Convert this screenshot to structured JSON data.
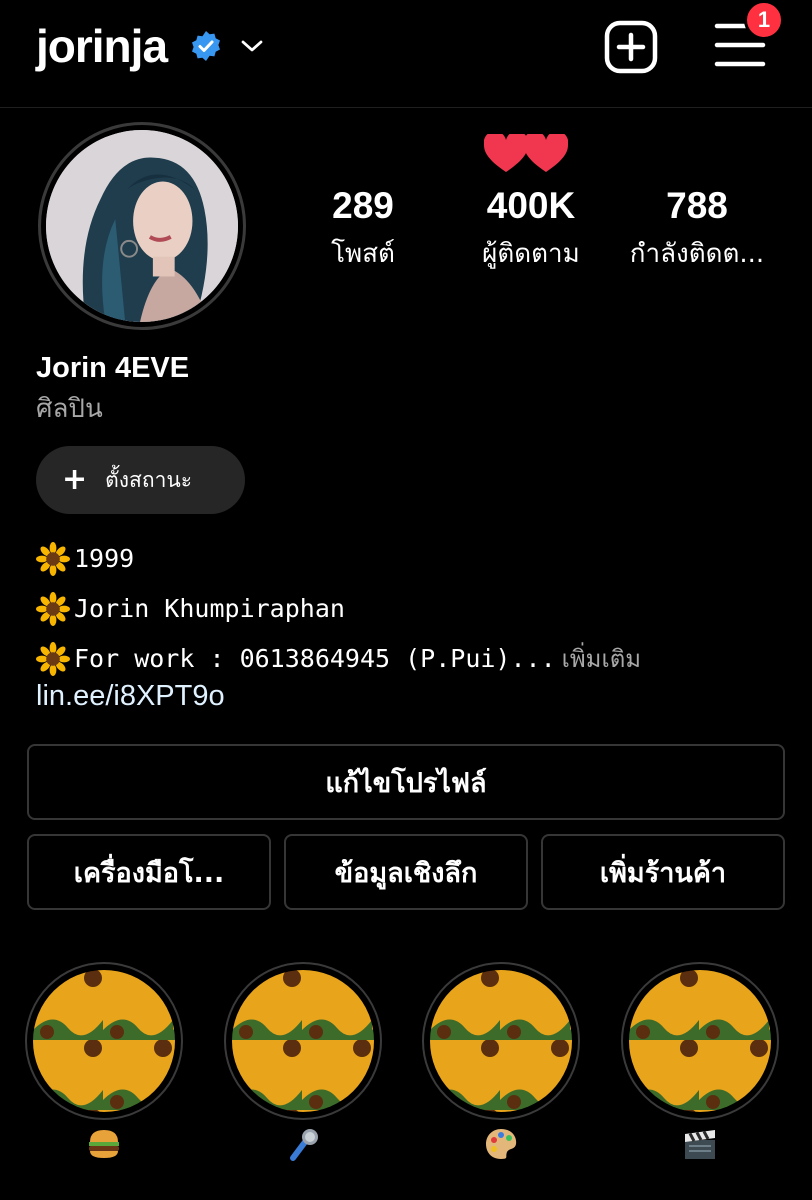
{
  "header": {
    "username": "jorinja",
    "notification_count": "1"
  },
  "profile": {
    "stats": [
      {
        "value": "289",
        "label": "โพสต์"
      },
      {
        "value": "400K",
        "label": "ผู้ติดตาม"
      },
      {
        "value": "788",
        "label": "กำลังติดต..."
      }
    ],
    "display_name": "Jorin 4EVE",
    "category": "ศิลปิน",
    "status_button": "ตั้งสถานะ",
    "bio": [
      "1999",
      "Jorin Khumpiraphan",
      "For work : 0613864945 (P.Pui)..."
    ],
    "bio_more": "เพิ่มเติม",
    "link": "lin.ee/i8XPT9o"
  },
  "actions": {
    "edit_profile": "แก้ไขโปรไฟล์",
    "tools": "เครื่องมือโ...",
    "insights": "ข้อมูลเชิงลึก",
    "add_shop": "เพิ่มร้านค้า"
  },
  "highlights": [
    {
      "icon": "hamburger-icon"
    },
    {
      "icon": "microphone-icon"
    },
    {
      "icon": "palette-icon"
    },
    {
      "icon": "clapper-board-icon"
    }
  ],
  "colors": {
    "background": "#000000",
    "verified": "#3897f0",
    "badge": "#ff3141",
    "heart": "#f0374f",
    "secondary_text": "#a8a8a8"
  }
}
